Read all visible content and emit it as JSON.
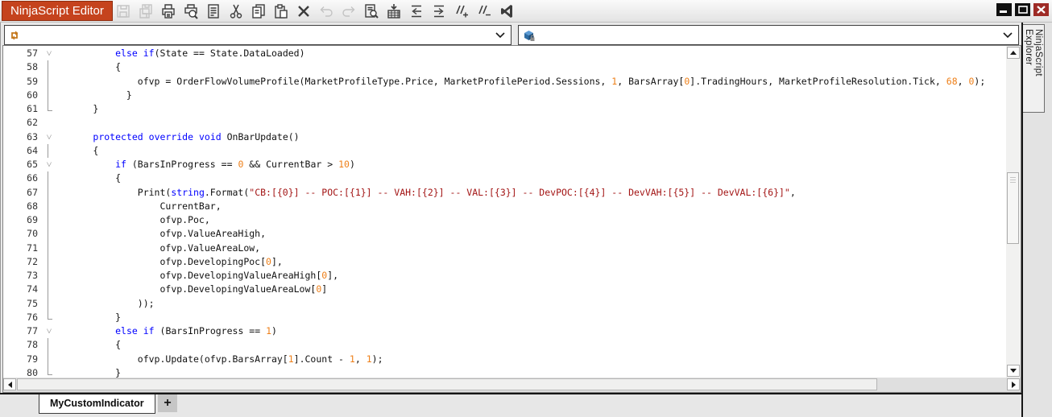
{
  "window": {
    "title": "NinjaScript Editor",
    "title_bg_color": "#C5431D",
    "controls": [
      {
        "name": "minimize"
      },
      {
        "name": "maximize"
      },
      {
        "name": "close"
      }
    ]
  },
  "toolbar": {
    "buttons": [
      {
        "name": "save",
        "enabled": false
      },
      {
        "name": "save-all",
        "enabled": false
      },
      {
        "name": "print",
        "enabled": true
      },
      {
        "name": "print-preview",
        "enabled": true
      },
      {
        "name": "document",
        "enabled": true
      },
      {
        "name": "cut",
        "enabled": true
      },
      {
        "name": "copy",
        "enabled": true
      },
      {
        "name": "paste",
        "enabled": true
      },
      {
        "name": "delete",
        "enabled": true
      },
      {
        "name": "undo",
        "enabled": false
      },
      {
        "name": "redo",
        "enabled": false
      },
      {
        "name": "find",
        "enabled": true
      },
      {
        "name": "compile",
        "enabled": true
      },
      {
        "name": "decrease-indent",
        "enabled": true
      },
      {
        "name": "increase-indent",
        "enabled": true
      },
      {
        "name": "comment",
        "enabled": true
      },
      {
        "name": "uncomment",
        "enabled": true
      },
      {
        "name": "visual-studio",
        "enabled": true
      }
    ]
  },
  "navigation": {
    "type_selector": {
      "icon": "class-icon",
      "value": ""
    },
    "member_selector": {
      "icon": "method-icon",
      "value": ""
    }
  },
  "explorer": {
    "label": "NinjaScript Explorer"
  },
  "editor": {
    "colors": {
      "keyword": "#0000FF",
      "number": "#EE7F18",
      "string": "#A31515",
      "plain": "#111111"
    },
    "lines": [
      {
        "num": "57",
        "fold": "open",
        "segs": [
          [
            "p",
            "            "
          ],
          [
            "k",
            "else"
          ],
          [
            "p",
            " "
          ],
          [
            "k",
            "if"
          ],
          [
            "p",
            "(State == State.DataLoaded)"
          ]
        ]
      },
      {
        "num": "58",
        "fold": "line",
        "segs": [
          [
            "p",
            "            {"
          ]
        ]
      },
      {
        "num": "59",
        "fold": "line",
        "segs": [
          [
            "p",
            "                ofvp = OrderFlowVolumeProfile(MarketProfileType.Price, MarketProfilePeriod.Sessions, "
          ],
          [
            "n",
            "1"
          ],
          [
            "p",
            ", BarsArray["
          ],
          [
            "n",
            "0"
          ],
          [
            "p",
            "].TradingHours, MarketProfileResolution.Tick, "
          ],
          [
            "n",
            "68"
          ],
          [
            "p",
            ", "
          ],
          [
            "n",
            "0"
          ],
          [
            "p",
            ");"
          ]
        ]
      },
      {
        "num": "60",
        "fold": "line",
        "segs": [
          [
            "p",
            "              }"
          ]
        ]
      },
      {
        "num": "61",
        "fold": "end",
        "segs": [
          [
            "p",
            "        }"
          ]
        ]
      },
      {
        "num": "62",
        "fold": "",
        "segs": []
      },
      {
        "num": "63",
        "fold": "open",
        "segs": [
          [
            "p",
            "        "
          ],
          [
            "k",
            "protected"
          ],
          [
            "p",
            " "
          ],
          [
            "k",
            "override"
          ],
          [
            "p",
            " "
          ],
          [
            "k",
            "void"
          ],
          [
            "p",
            " OnBarUpdate()"
          ]
        ]
      },
      {
        "num": "64",
        "fold": "line",
        "segs": [
          [
            "p",
            "        {"
          ]
        ]
      },
      {
        "num": "65",
        "fold": "open",
        "segs": [
          [
            "p",
            "            "
          ],
          [
            "k",
            "if"
          ],
          [
            "p",
            " (BarsInProgress == "
          ],
          [
            "n",
            "0"
          ],
          [
            "p",
            " && CurrentBar > "
          ],
          [
            "n",
            "10"
          ],
          [
            "p",
            ")"
          ]
        ]
      },
      {
        "num": "66",
        "fold": "line",
        "segs": [
          [
            "p",
            "            {"
          ]
        ]
      },
      {
        "num": "67",
        "fold": "line",
        "segs": [
          [
            "p",
            "                Print("
          ],
          [
            "k",
            "string"
          ],
          [
            "p",
            ".Format("
          ],
          [
            "s",
            "\"CB:[{0}] -- POC:[{1}] -- VAH:[{2}] -- VAL:[{3}] -- DevPOC:[{4}] -- DevVAH:[{5}] -- DevVAL:[{6}]\""
          ],
          [
            "p",
            ","
          ]
        ]
      },
      {
        "num": "68",
        "fold": "line",
        "segs": [
          [
            "p",
            "                    CurrentBar,"
          ]
        ]
      },
      {
        "num": "69",
        "fold": "line",
        "segs": [
          [
            "p",
            "                    ofvp.Poc,"
          ]
        ]
      },
      {
        "num": "70",
        "fold": "line",
        "segs": [
          [
            "p",
            "                    ofvp.ValueAreaHigh,"
          ]
        ]
      },
      {
        "num": "71",
        "fold": "line",
        "segs": [
          [
            "p",
            "                    ofvp.ValueAreaLow,"
          ]
        ]
      },
      {
        "num": "72",
        "fold": "line",
        "segs": [
          [
            "p",
            "                    ofvp.DevelopingPoc["
          ],
          [
            "n",
            "0"
          ],
          [
            "p",
            "],"
          ]
        ]
      },
      {
        "num": "73",
        "fold": "line",
        "segs": [
          [
            "p",
            "                    ofvp.DevelopingValueAreaHigh["
          ],
          [
            "n",
            "0"
          ],
          [
            "p",
            "],"
          ]
        ]
      },
      {
        "num": "74",
        "fold": "line",
        "segs": [
          [
            "p",
            "                    ofvp.DevelopingValueAreaLow["
          ],
          [
            "n",
            "0"
          ],
          [
            "p",
            "]"
          ]
        ]
      },
      {
        "num": "75",
        "fold": "line",
        "segs": [
          [
            "p",
            "                ));"
          ]
        ]
      },
      {
        "num": "76",
        "fold": "end",
        "segs": [
          [
            "p",
            "            }"
          ]
        ]
      },
      {
        "num": "77",
        "fold": "open",
        "segs": [
          [
            "p",
            "            "
          ],
          [
            "k",
            "else"
          ],
          [
            "p",
            " "
          ],
          [
            "k",
            "if"
          ],
          [
            "p",
            " (BarsInProgress == "
          ],
          [
            "n",
            "1"
          ],
          [
            "p",
            ")"
          ]
        ]
      },
      {
        "num": "78",
        "fold": "line",
        "segs": [
          [
            "p",
            "            {"
          ]
        ]
      },
      {
        "num": "79",
        "fold": "line",
        "segs": [
          [
            "p",
            "                ofvp.Update(ofvp.BarsArray["
          ],
          [
            "n",
            "1"
          ],
          [
            "p",
            "].Count - "
          ],
          [
            "n",
            "1"
          ],
          [
            "p",
            ", "
          ],
          [
            "n",
            "1"
          ],
          [
            "p",
            ");"
          ]
        ]
      },
      {
        "num": "80",
        "fold": "end",
        "segs": [
          [
            "p",
            "            }"
          ]
        ]
      }
    ]
  },
  "tabs": {
    "active_label": "MyCustomIndicator",
    "add_label": "+"
  }
}
